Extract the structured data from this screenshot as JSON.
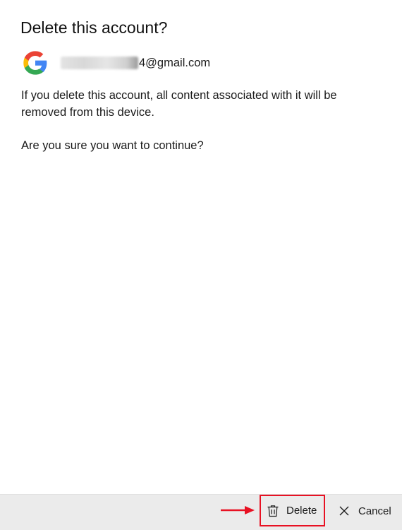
{
  "dialog": {
    "title": "Delete this account?",
    "account": {
      "provider_icon": "google-g-icon",
      "email_visible_suffix": "4@gmail.com"
    },
    "message": "If you delete this account, all content associated with it will be removed from this device.",
    "question": "Are you sure you want to continue?"
  },
  "footer": {
    "delete_label": "Delete",
    "delete_icon": "trash-icon",
    "cancel_label": "Cancel",
    "cancel_icon": "close-icon",
    "annotation_arrow_icon": "arrow-right-icon"
  },
  "colors": {
    "footer_background": "#ebebeb",
    "annotation_red": "#e81123",
    "google_blue": "#4285F4",
    "google_red": "#EA4335",
    "google_yellow": "#FBBC05",
    "google_green": "#34A853"
  }
}
